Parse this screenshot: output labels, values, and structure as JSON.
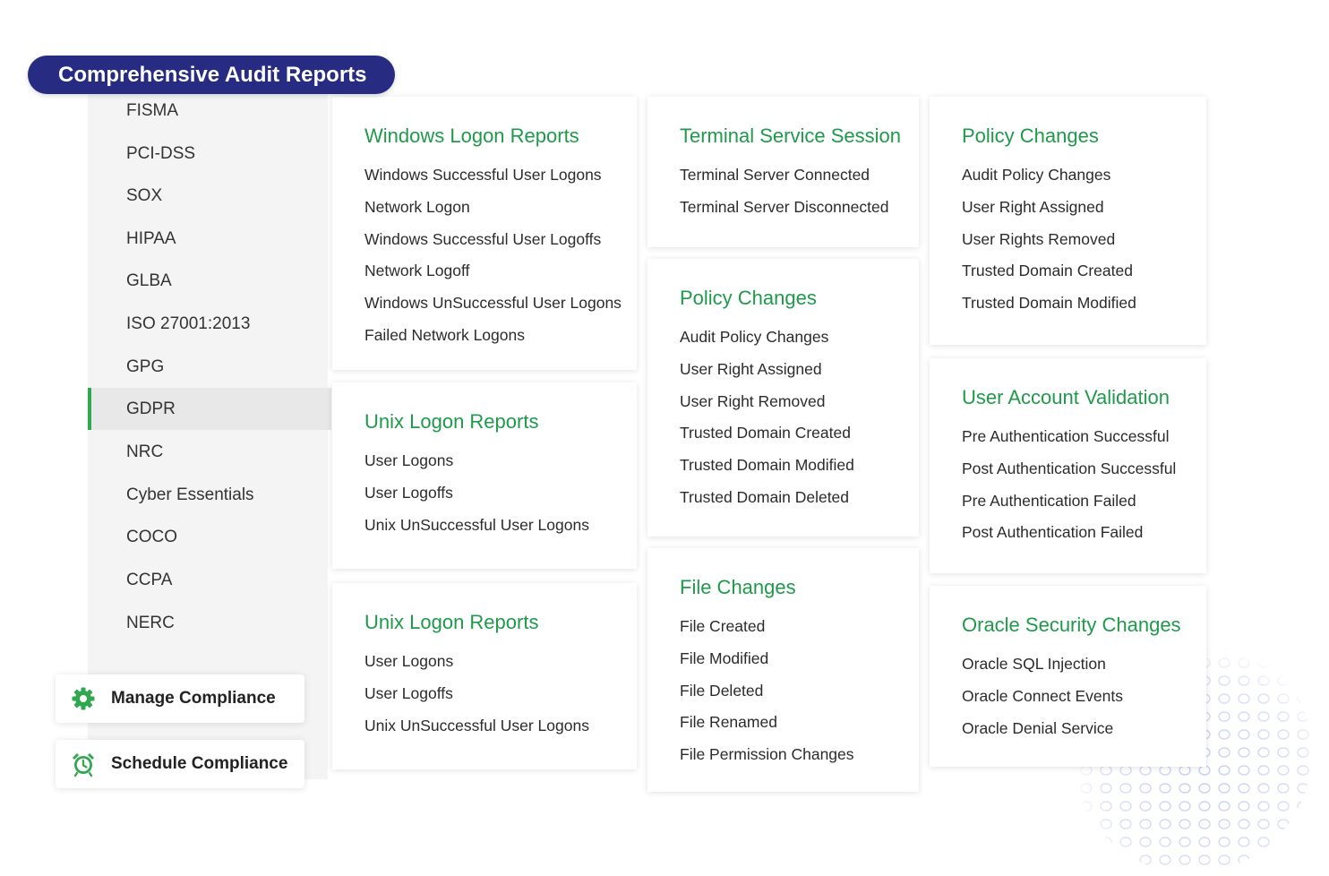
{
  "header": {
    "title": "Comprehensive Audit Reports"
  },
  "sidebar": {
    "items": [
      {
        "label": "FISMA"
      },
      {
        "label": "PCI-DSS"
      },
      {
        "label": "SOX"
      },
      {
        "label": "HIPAA"
      },
      {
        "label": "GLBA"
      },
      {
        "label": "ISO 27001:2013"
      },
      {
        "label": "GPG"
      },
      {
        "label": "GDPR",
        "active": true
      },
      {
        "label": "NRC"
      },
      {
        "label": "Cyber Essentials"
      },
      {
        "label": "COCO"
      },
      {
        "label": "CCPA"
      },
      {
        "label": "NERC"
      }
    ],
    "active_color": "#2fa84f"
  },
  "actions": {
    "manage": {
      "label": "Manage Compliance",
      "icon": "gear-icon"
    },
    "schedule": {
      "label": "Schedule Compliance",
      "icon": "alarm-clock-icon"
    }
  },
  "colors": {
    "banner": "#272c82",
    "accent_green": "#1f9a4b"
  },
  "cards": {
    "windows_logon": {
      "title": "Windows Logon Reports",
      "items": [
        "Windows Successful User Logons",
        "Network Logon",
        "Windows Successful User Logoffs",
        "Network Logoff",
        "Windows UnSuccessful User Logons",
        "Failed Network Logons"
      ]
    },
    "unix_logon_1": {
      "title": "Unix Logon Reports",
      "items": [
        "User Logons",
        "User Logoffs",
        "Unix UnSuccessful User Logons"
      ]
    },
    "unix_logon_2": {
      "title": "Unix Logon Reports",
      "items": [
        "User Logons",
        "User Logoffs",
        "Unix UnSuccessful User Logons"
      ]
    },
    "terminal_service": {
      "title": "Terminal Service Session",
      "items": [
        "Terminal Server Connected",
        "Terminal Server Disconnected"
      ]
    },
    "policy_changes_mid": {
      "title": "Policy Changes",
      "items": [
        "Audit Policy Changes",
        "User Right Assigned",
        "User Right Removed",
        "Trusted Domain Created",
        "Trusted Domain Modified",
        "Trusted Domain Deleted"
      ]
    },
    "file_changes": {
      "title": "File Changes",
      "items": [
        "File Created",
        "File Modified",
        "File Deleted",
        "File Renamed",
        "File Permission Changes"
      ]
    },
    "policy_changes_right": {
      "title": "Policy Changes",
      "items": [
        "Audit Policy Changes",
        "User Right Assigned",
        "User Rights Removed",
        "Trusted Domain Created",
        "Trusted Domain Modified"
      ]
    },
    "user_account_validation": {
      "title": "User Account Validation",
      "items": [
        "Pre Authentication Successful",
        "Post Authentication Successful",
        "Pre Authentication Failed",
        "Post Authentication Failed"
      ]
    },
    "oracle_security": {
      "title": "Oracle Security Changes",
      "items": [
        "Oracle SQL Injection",
        "Oracle Connect Events",
        "Oracle Denial Service"
      ]
    }
  }
}
